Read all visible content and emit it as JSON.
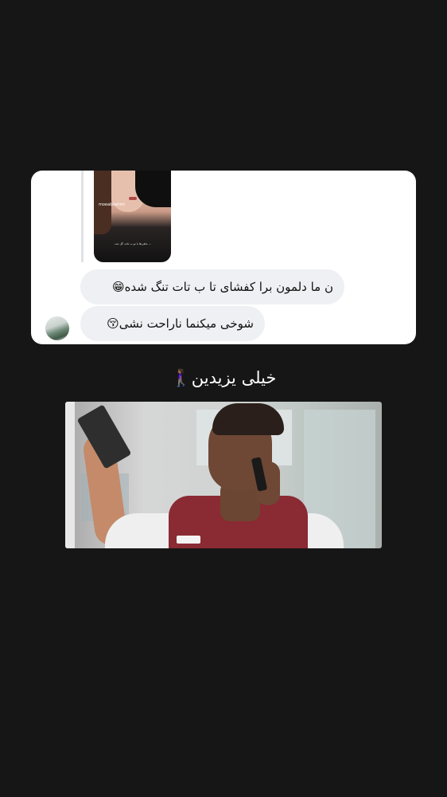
{
  "chat_card": {
    "reply_thumbnail": {
      "username": "moeabkarimi",
      "caption": "ماهی‌ها با تو ب تاتت گل تنت ..."
    },
    "messages": [
      {
        "text": "ن ما دلمون برا کفشای تا ب تات تنگ شده😁"
      },
      {
        "text": "شوخی میکنما ناراحت نشی😚"
      }
    ]
  },
  "headline": {
    "text": "خیلی یزیدین🚶🏾‍♀️"
  }
}
